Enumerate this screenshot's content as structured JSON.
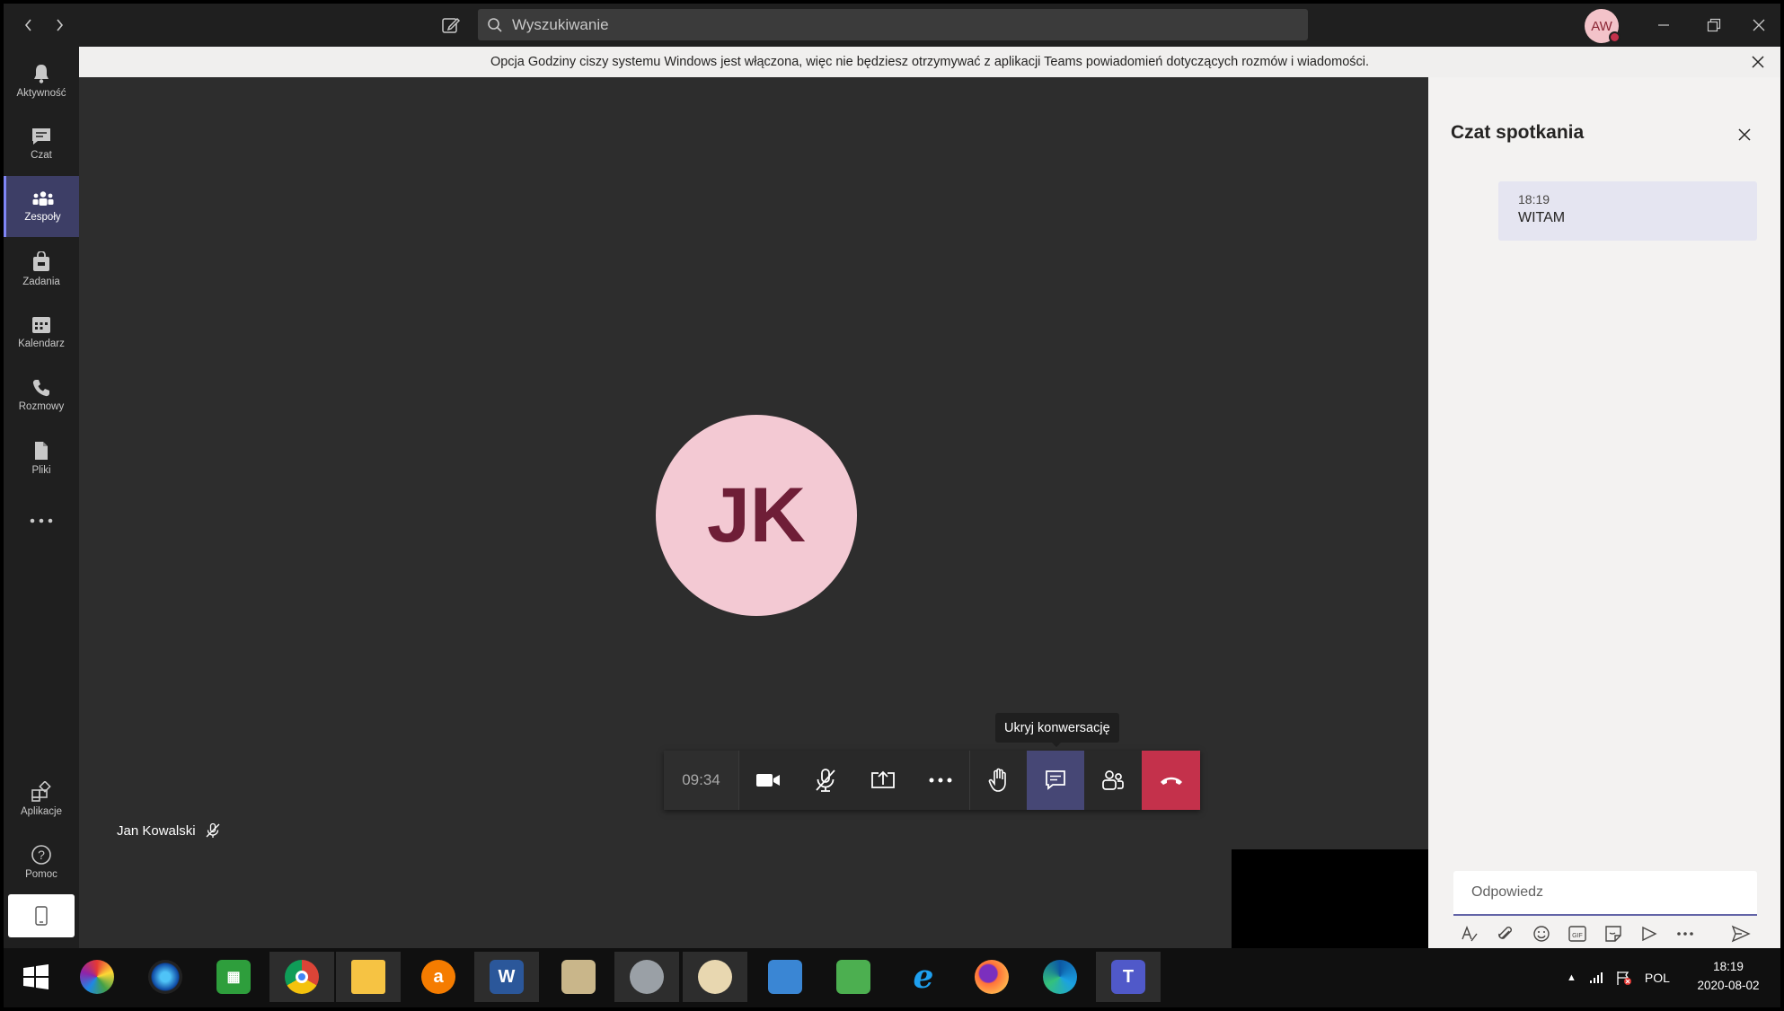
{
  "search": {
    "placeholder": "Wyszukiwanie"
  },
  "user": {
    "initials": "AW"
  },
  "rail": {
    "items": [
      {
        "label": "Aktywność",
        "icon": "bell-icon"
      },
      {
        "label": "Czat",
        "icon": "chat-icon"
      },
      {
        "label": "Zespoły",
        "icon": "teams-icon",
        "active": true
      },
      {
        "label": "Zadania",
        "icon": "tasks-icon"
      },
      {
        "label": "Kalendarz",
        "icon": "calendar-icon"
      },
      {
        "label": "Rozmowy",
        "icon": "phone-icon"
      },
      {
        "label": "Pliki",
        "icon": "files-icon"
      }
    ],
    "bottom": [
      {
        "label": "Aplikacje",
        "icon": "apps-icon"
      },
      {
        "label": "Pomoc",
        "icon": "help-icon"
      }
    ]
  },
  "banner": {
    "text": "Opcja Godziny ciszy systemu Windows jest włączona, więc nie będziesz otrzymywać z aplikacji Teams powiadomień dotyczących rozmów i wiadomości."
  },
  "meeting": {
    "participant_initials": "JK",
    "participant_name": "Jan Kowalski",
    "timer": "09:34",
    "tooltip": "Ukryj konwersację"
  },
  "chat": {
    "title": "Czat spotkania",
    "messages": [
      {
        "time": "18:19",
        "text": "WITAM"
      }
    ],
    "reply_placeholder": "Odpowiedz"
  },
  "taskbar": {
    "lang": "POL",
    "time": "18:19",
    "date": "2020-08-02"
  },
  "colors": {
    "accent": "#6264a7",
    "rail_active": "#3d3e66",
    "hangup": "#c4314b",
    "avatar_bg": "#f3c9d3",
    "avatar_fg": "#6f1e37"
  }
}
